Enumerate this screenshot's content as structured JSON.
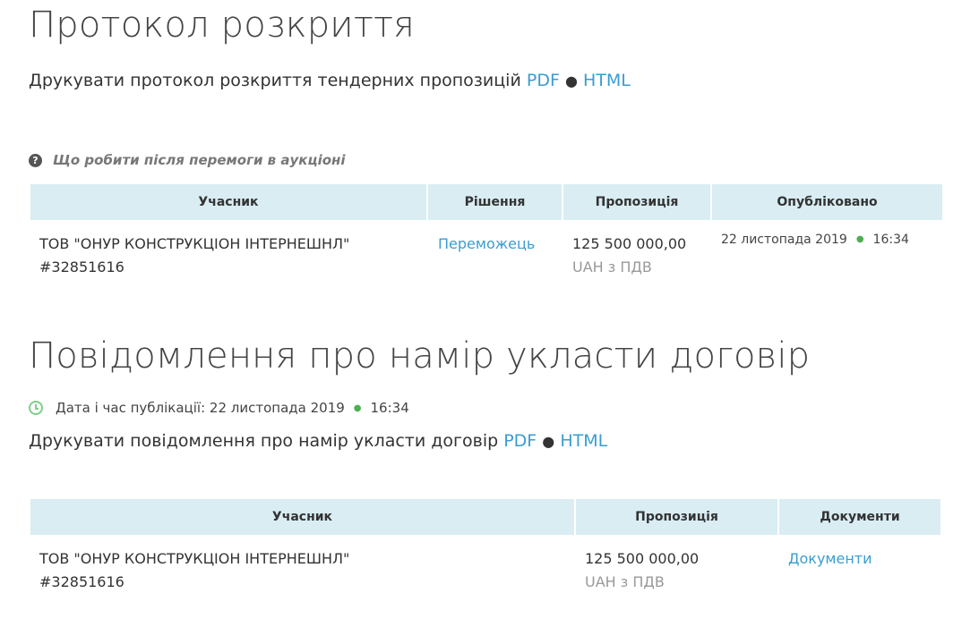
{
  "opening": {
    "title": "Протокол розкриття",
    "print_text": "Друкувати протокол розкриття тендерних пропозицій",
    "pdf_label": "PDF",
    "separator": "●",
    "html_label": "HTML",
    "hint": "Що робити після перемоги в аукціоні",
    "table": {
      "headers": [
        "Учасник",
        "Рішення",
        "Пропозиція",
        "Опубліковано"
      ],
      "row": {
        "participant": "ТОВ \"ОНУР КОНСТРУКЦІОН ІНТЕРНЕШНЛ\"",
        "participant_id": "#32851616",
        "decision": "Переможець",
        "amount": "125 500 000,00",
        "currency": "UAH з ПДВ",
        "date": "22 листопада 2019",
        "time": "16:34"
      }
    }
  },
  "notice": {
    "title": "Повідомлення про намір укласти договір",
    "pub_label": "Дата і час публікації: 22 листопада 2019",
    "pub_time": "16:34",
    "print_text": "Друкувати повідомлення про намір укласти договір",
    "pdf_label": "PDF",
    "separator": "●",
    "html_label": "HTML",
    "table": {
      "headers": [
        "Учасник",
        "Пропозиція",
        "Документи"
      ],
      "row": {
        "participant": "ТОВ \"ОНУР КОНСТРУКЦІОН ІНТЕРНЕШНЛ\"",
        "participant_id": "#32851616",
        "amount": "125 500 000,00",
        "currency": "UAH з ПДВ",
        "documents_link": "Документи"
      }
    }
  },
  "colors": {
    "link": "#3a9dd1",
    "header_bg": "#d9edf3",
    "accent_green": "#4caf50"
  }
}
